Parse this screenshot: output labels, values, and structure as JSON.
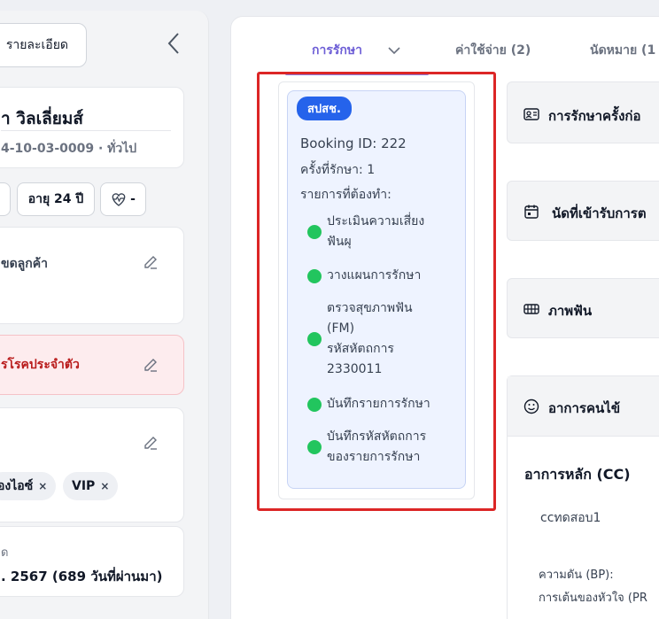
{
  "left": {
    "detail_button": "รายละเอียด",
    "patient_name": "า วิลเลี่ยมส์",
    "hn_line": "4-10-03-0009 · ทั่วไป",
    "age": "อายุ 24 ปี",
    "vitals_label": "-",
    "customer_card_title": "ขดลูกค้า",
    "disease_card_title": "รโรคประจำตัว",
    "tags": [
      "องไอซ์",
      "VIP"
    ],
    "tag_close": "×",
    "last_visit_label": "ด",
    "last_visit_value": ". 2567 (689 วันที่ผ่านมา)"
  },
  "tabs": {
    "treatment": "การรักษา",
    "expenses": "ค่าใช้จ่าย (2)",
    "appointments": "นัดหมาย (1"
  },
  "booking": {
    "badge": "สปสช.",
    "booking_id": "Booking ID: 222",
    "visit_no": "ครั้งที่รักษา: 1",
    "todo_header": "รายการที่ต้องทำ:",
    "todos": [
      "ประเมินความเสี่ยง\nฟันผุ",
      "วางแผนการรักษา",
      "ตรวจสุขภาพฟัน\n(FM)\nรหัสหัตถการ\n2330011",
      "บันทึกรายการรักษา",
      "บันทึกรหัสหัตถการ\nของรายการรักษา"
    ]
  },
  "sections": {
    "prev_treatment": "การรักษาครั้งก่อ",
    "appointment": "นัดที่เข้ารับการต",
    "dental_image": "ภาพฟัน",
    "symptoms": "อาการคนไข้"
  },
  "symptoms": {
    "cc_title": "อาการหลัก (CC)",
    "cc_value": "ccทดสอบ1",
    "bp_label": "ความดัน (BP):",
    "pulse_label": "การเต้นของหัวใจ (PR"
  },
  "colors": {
    "accent": "#6d5ed6",
    "badge": "#2563eb",
    "done_dot": "#22c55e",
    "highlight": "#dc2626"
  }
}
